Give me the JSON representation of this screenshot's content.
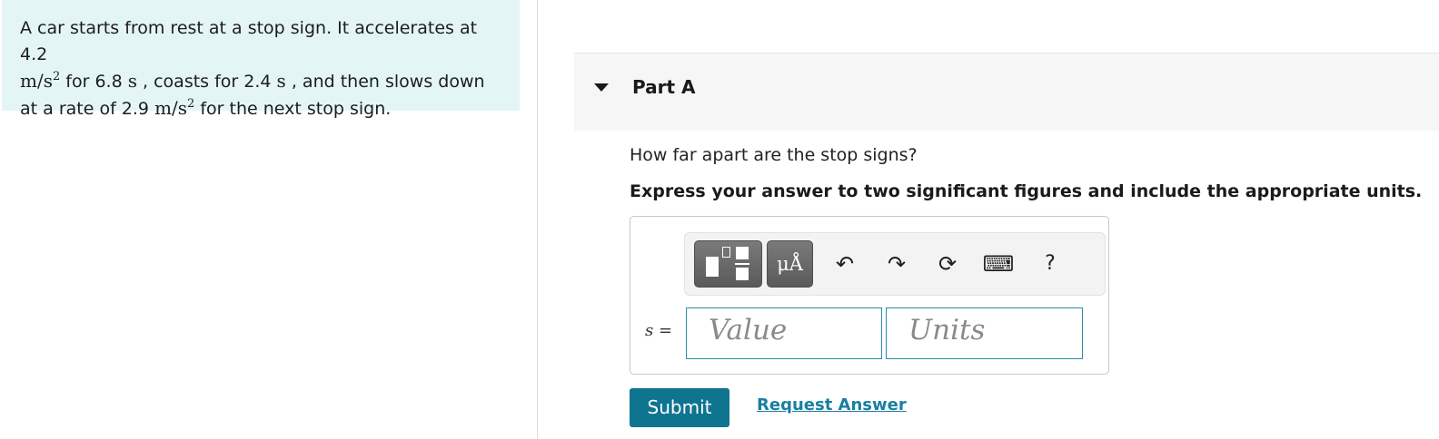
{
  "problem": {
    "seg1": "A car starts from rest at a stop sign. It accelerates at 4.2",
    "unit_accel_a": "m/s",
    "sup": "2",
    "seg2": " for 6.8",
    "unit_s1": "s",
    "seg3": " , coasts for 2.4",
    "unit_s2": "s",
    "seg4": " , and then slows down at a rate of 2.9",
    "unit_accel_b": "m/s",
    "seg5": " for the next stop sign."
  },
  "part": {
    "title": "Part A",
    "question": "How far apart are the stop signs?",
    "instruction": "Express your answer to two significant figures and include the appropriate units."
  },
  "toolbar": {
    "units_label": "μÅ",
    "undo_glyph": "↶",
    "redo_glyph": "↷",
    "reset_glyph": "⟳",
    "keyboard_glyph": "⌨",
    "help_label": "?",
    "icons": [
      "templates-icon",
      "units-icon",
      "undo-icon",
      "redo-icon",
      "reset-icon",
      "keyboard-icon",
      "help-icon"
    ]
  },
  "answer": {
    "variable": "s",
    "equals": "=",
    "value_placeholder": "Value",
    "units_placeholder": "Units"
  },
  "actions": {
    "submit_label": "Submit",
    "request_label": "Request Answer"
  },
  "colors": {
    "problem_bg": "#e4f5f5",
    "submit_bg": "#0f7490",
    "link": "#1a7fa0",
    "input_border": "#2a8ea8"
  }
}
